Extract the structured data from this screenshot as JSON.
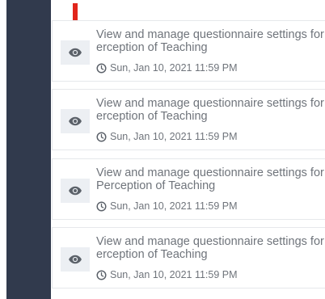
{
  "items": [
    {
      "title_line1": "View and manage questionnaire settings for",
      "title_line2": "erception of Teaching",
      "due": "Sun, Jan 10, 2021 11:59 PM"
    },
    {
      "title_line1": "View and manage questionnaire settings for",
      "title_line2": "erception of Teaching",
      "due": "Sun, Jan 10, 2021 11:59 PM"
    },
    {
      "title_line1": "View and manage questionnaire settings for",
      "title_line2": "Perception of Teaching",
      "due": "Sun, Jan 10, 2021 11:59 PM"
    },
    {
      "title_line1": "View and manage questionnaire settings for",
      "title_line2": "erception of Teaching",
      "due": "Sun, Jan 10, 2021 11:59 PM"
    }
  ],
  "icons": {
    "view": "eye-icon",
    "due": "clock-icon",
    "pointer": "arrow-down-icon"
  },
  "colors": {
    "sidebar": "#313a4d",
    "arrow": "#e1251b",
    "text": "#6f747b",
    "icon_bg": "#eceff3"
  }
}
